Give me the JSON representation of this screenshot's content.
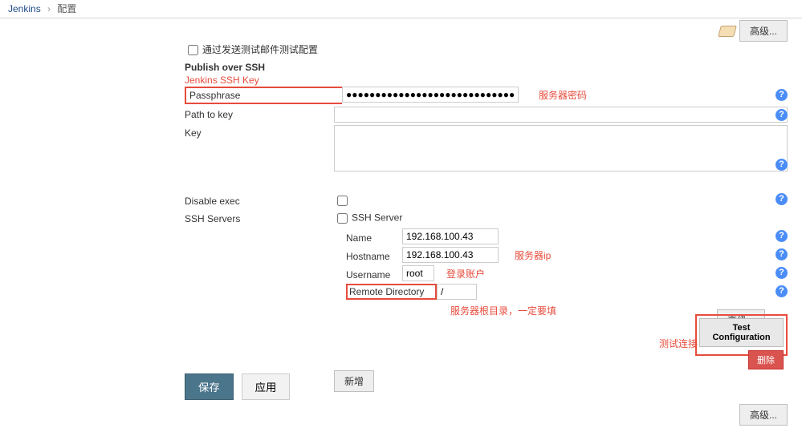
{
  "breadcrumb": {
    "root": "Jenkins",
    "page": "配置",
    "sep": "›"
  },
  "toolbar": {
    "adv": "高级..."
  },
  "mail": {
    "label": "通过发送测试邮件测试配置"
  },
  "ssh": {
    "title": "Publish over SSH",
    "keyTitle": "Jenkins SSH Key",
    "passphrase": {
      "label": "Passphrase",
      "value": "●●●●●●●●●●●●●●●●●●●●●●●●●●●●●●●●●●●●●●●●●●",
      "note": "服务器密码"
    },
    "pathToKey": {
      "label": "Path to key",
      "value": ""
    },
    "key": {
      "label": "Key",
      "value": ""
    },
    "disableExec": {
      "label": "Disable exec"
    },
    "servers": {
      "label": "SSH Servers",
      "server": "SSH Server",
      "name": {
        "label": "Name",
        "value": "192.168.100.43"
      },
      "hostname": {
        "label": "Hostname",
        "value": "192.168.100.43",
        "note": "服务器ip"
      },
      "username": {
        "label": "Username",
        "value": "root",
        "note": "登录账户"
      },
      "remoteDir": {
        "label": "Remote Directory",
        "value": "/",
        "note": "服务器根目录，一定要填"
      }
    },
    "adv": "高级...",
    "testConf": "Test Configuration",
    "testNote": "测试连接",
    "del": "删除",
    "add": "新增",
    "adv2": "高级..."
  },
  "footer": {
    "save": "保存",
    "apply": "应用"
  }
}
